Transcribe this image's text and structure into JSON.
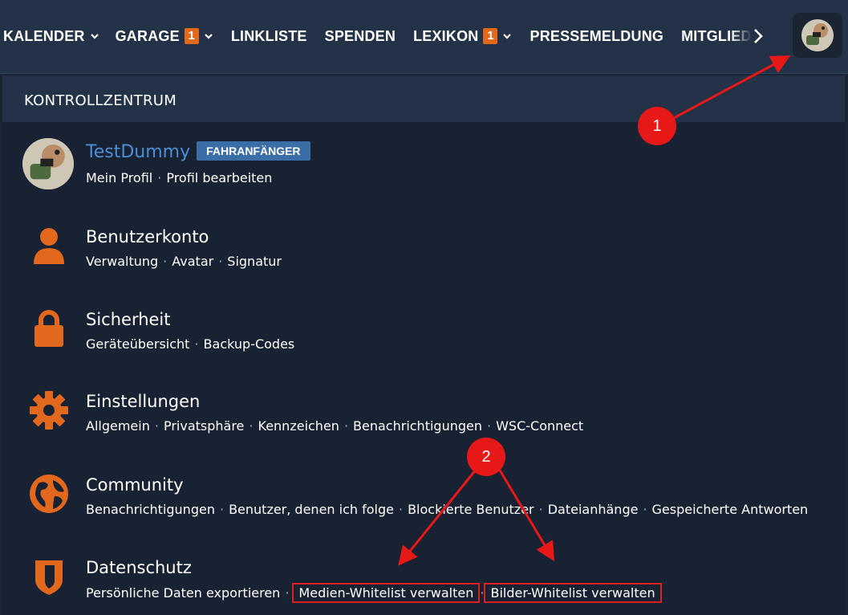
{
  "nav": {
    "items": [
      {
        "label": "KALENDER",
        "dropdown": true
      },
      {
        "label": "GARAGE",
        "badge": "1",
        "dropdown": true
      },
      {
        "label": "LINKLISTE"
      },
      {
        "label": "SPENDEN"
      },
      {
        "label": "LEXIKON",
        "badge": "1",
        "dropdown": true
      },
      {
        "label": "PRESSEMELDUNG"
      }
    ],
    "overflow_label": "MITGLIED",
    "next_icon": "chevron-right-icon",
    "avatar_icon": "user-avatar"
  },
  "panel": {
    "title": "KONTROLLZENTRUM",
    "user": {
      "name": "TestDummy",
      "rank": "FAHRANFÄNGER",
      "links": [
        "Mein Profil",
        "Profil bearbeiten"
      ]
    },
    "sections": [
      {
        "title": "Benutzerkonto",
        "icon": "user-icon",
        "links": [
          "Verwaltung",
          "Avatar",
          "Signatur"
        ]
      },
      {
        "title": "Sicherheit",
        "icon": "lock-icon",
        "links": [
          "Geräteübersicht",
          "Backup-Codes"
        ]
      },
      {
        "title": "Einstellungen",
        "icon": "gear-icon",
        "links": [
          "Allgemein",
          "Privatsphäre",
          "Kennzeichen",
          "Benachrichtigungen",
          "WSC-Connect"
        ]
      },
      {
        "title": "Community",
        "icon": "globe-icon",
        "links": [
          "Benachrichtigungen",
          "Benutzer, denen ich folge",
          "Blockierte Benutzer",
          "Dateianhänge",
          "Gespeicherte Antworten"
        ]
      },
      {
        "title": "Datenschutz",
        "icon": "shield-icon",
        "links": [
          "Persönliche Daten exportieren",
          "Medien-Whitelist verwalten",
          "Bilder-Whitelist verwalten"
        ]
      }
    ],
    "separator": "·"
  },
  "annotations": {
    "marker_1": "1",
    "marker_2": "2"
  },
  "colors": {
    "accent": "#e2681e",
    "link_blue": "#4a8ed8",
    "rank_badge": "#3b6ea7",
    "annotation_red": "#e61818",
    "header_bg": "#243247",
    "panel_bg": "#182232"
  }
}
